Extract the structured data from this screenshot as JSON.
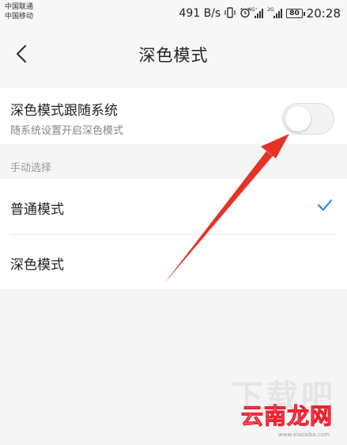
{
  "status_bar": {
    "carrier1": "中国联通",
    "carrier2": "中国移动",
    "speed": "491 B/s",
    "network_tag1": "4G⁺",
    "network_tag2": "2G",
    "battery": "80",
    "time": "20:28"
  },
  "header": {
    "title": "深色模式"
  },
  "follow_system": {
    "title": "深色模式跟随系统",
    "subtitle": "随系统设置开启深色模式",
    "enabled": false
  },
  "manual": {
    "section_label": "手动选择",
    "options": [
      {
        "label": "普通模式",
        "selected": true
      },
      {
        "label": "深色模式",
        "selected": false
      }
    ]
  },
  "watermark": {
    "big": "下载吧",
    "logo": "云南龙网",
    "url": "www.xiazaiba.com"
  },
  "colors": {
    "accent": "#2f7be8",
    "annotation": "#e63224",
    "background": "#f5f5f5"
  }
}
